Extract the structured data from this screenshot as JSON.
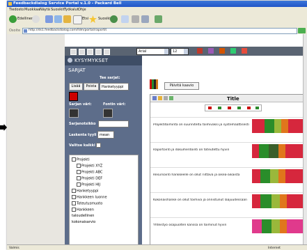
{
  "window": {
    "title": "Feedbackdialog Service Portal v.1.0 - Packard Bell"
  },
  "menubar": {
    "items": [
      "Tiedosto",
      "Muokkaa",
      "Näytä",
      "Suosikit",
      "Työkalut",
      "Ohje"
    ]
  },
  "toolbar": {
    "back": "Edellinen",
    "search": "Etsi",
    "favorites": "Suosikit"
  },
  "address": {
    "label": "Osoite",
    "url": "http://ds1.feedbackdialog.com/fdm/portal/raportit"
  },
  "app_toolbar": {
    "font": "Arial",
    "size": "12"
  },
  "panel": {
    "header": "KYSYMYKSET",
    "sarjat": "SARJAT",
    "tee_sarjat": "Tee sarjat:",
    "lisaa": "Lisää",
    "poista": "Poista",
    "hanketyyppi": "Hanketyyppi",
    "sarjan_vari": "Sarjan väri:",
    "fontin_vari": "Fontin väri:",
    "sarjanotsikko": "Sarjanotsikko",
    "laskenta_tyyli": "Laskenta tyyli",
    "laskenta_value": "mean",
    "valitse_kaikki": "Valitse kaikki",
    "tree": [
      "Projekti",
      "Projekti XYZ",
      "Projekti ABC",
      "Projekti DEF",
      "Projekti HIJ",
      "Hanketyyppi",
      "Hankkeen luonne",
      "Toteutusmuoto",
      "Hankkeen",
      "taloudellinen",
      "kokonaisarvio"
    ]
  },
  "main": {
    "button": "Päivitä kaavio",
    "title": "Title"
  },
  "rows": [
    "Projektitoiminta on suunniteltu toimivaksi ja systemaattisesti",
    "Raportointi ja dokumentointi on toteutettu hyvin",
    "Resursointi hankkeelle on ollut riittävä ja oikea-aikaista",
    "Kokonaishanke on ollut toimiva ja onnistunut laajuudessaan",
    "Yhteistyö osapuolten kanssa on toiminut hyvin"
  ],
  "statusbar": {
    "left": "Valmis",
    "right": "Internet"
  }
}
